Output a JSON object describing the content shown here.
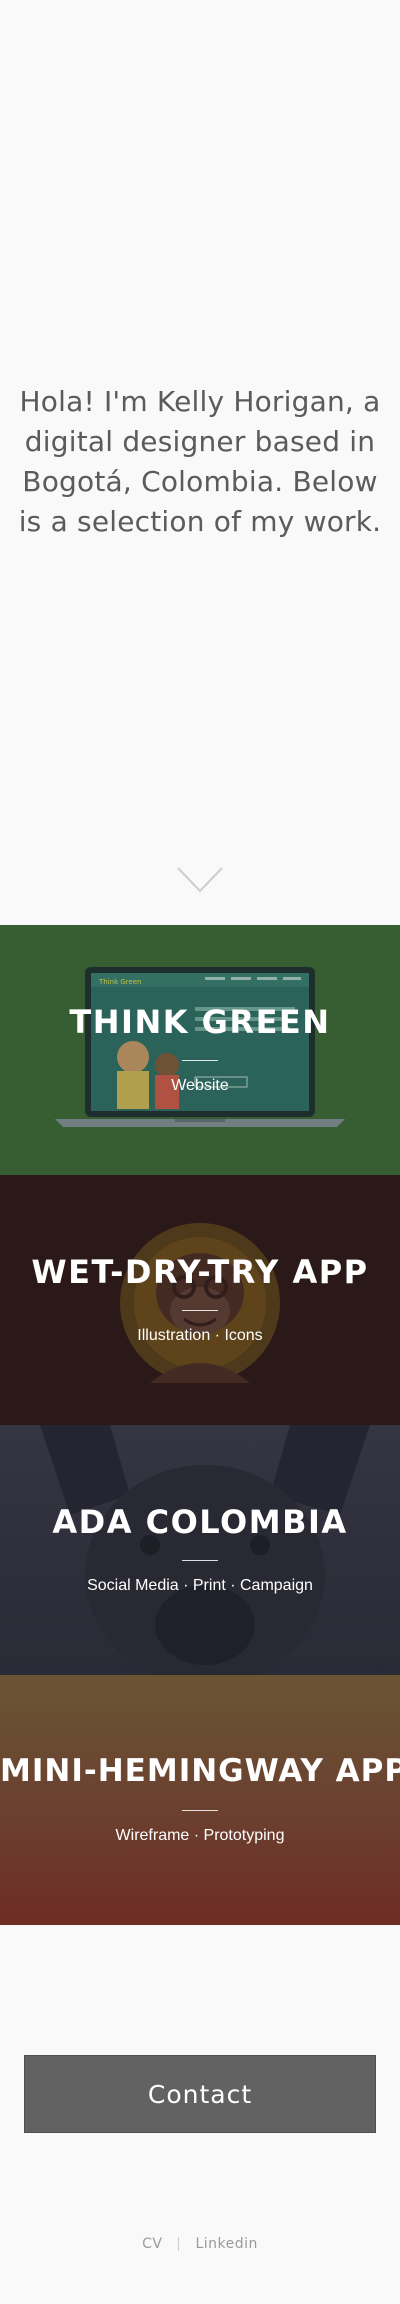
{
  "intro": {
    "text": "Hola! I'm Kelly Horigan, a digital designer based in Bogotá, Colombia. Below is a selection of my work."
  },
  "scroll_icon": "chevron-down-icon",
  "projects": [
    {
      "title": "THINK GREEN",
      "tags": "Website",
      "image": "laptop-mockup"
    },
    {
      "title": "WET-DRY-TRY APP",
      "tags": "Illustration · Icons",
      "image": "monkey-illustration"
    },
    {
      "title": "ADA COLOMBIA",
      "tags": "Social Media · Print · Campaign",
      "image": "dog-photo"
    },
    {
      "title": "MINI-HEMINGWAY APP",
      "tags": "Wireframe · Prototyping",
      "image": "gradient-background"
    }
  ],
  "laptop_screen": {
    "brand": "Think Green"
  },
  "contact": {
    "label": "Contact"
  },
  "footer": {
    "cv": "CV",
    "linkedin": "Linkedin"
  },
  "colors": {
    "background": "#f9f9f9",
    "think_green": "#3f6a36",
    "wet_dry_try": "#2e1c1c",
    "contact_button": "#626262"
  }
}
